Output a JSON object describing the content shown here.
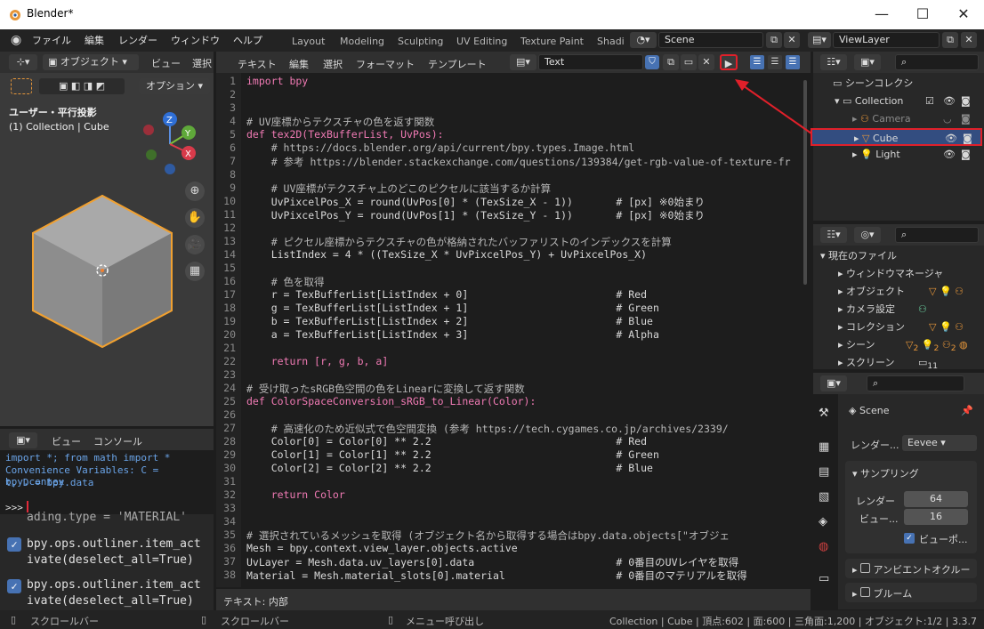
{
  "window": {
    "title": "Blender*",
    "minimize": "—",
    "maximize": "☐",
    "close": "✕"
  },
  "menus": [
    "ファイル",
    "編集",
    "レンダー",
    "ウィンドウ",
    "ヘルプ"
  ],
  "workspaces": [
    "Layout",
    "Modeling",
    "Sculpting",
    "UV Editing",
    "Texture Paint",
    "Shadi"
  ],
  "scene": {
    "name": "Scene"
  },
  "view_layer": {
    "name": "ViewLayer"
  },
  "viewport": {
    "mode": "オブジェクト",
    "menu": [
      "ビュー",
      "選択"
    ],
    "options": "オプション",
    "title": "ユーザー・平行投影",
    "subtitle": "(1) Collection | Cube",
    "axes": {
      "x": "X",
      "y": "Y",
      "z": "Z"
    }
  },
  "text_editor": {
    "menus": [
      "テキスト",
      "編集",
      "選択",
      "フォーマット",
      "テンプレート"
    ],
    "file_name": "Text",
    "footer": "テキスト: 内部",
    "lines": [
      {
        "n": "1",
        "t": "import bpy"
      },
      {
        "n": "2",
        "t": ""
      },
      {
        "n": "3",
        "t": ""
      },
      {
        "n": "4",
        "t": "# UV座標からテクスチャの色を返す関数"
      },
      {
        "n": "5",
        "t": "def tex2D(TexBufferList, UvPos):"
      },
      {
        "n": "6",
        "t": "    # https://docs.blender.org/api/current/bpy.types.Image.html"
      },
      {
        "n": "7",
        "t": "    # 参考 https://blender.stackexchange.com/questions/139384/get-rgb-value-of-texture-fr"
      },
      {
        "n": "8",
        "t": ""
      },
      {
        "n": "9",
        "t": "    # UV座標がテクスチャ上のどこのピクセルに該当するか計算"
      },
      {
        "n": "10",
        "t": "    UvPixcelPos_X = round(UvPos[0] * (TexSize_X - 1))       # [px] ※0始まり"
      },
      {
        "n": "11",
        "t": "    UvPixcelPos_Y = round(UvPos[1] * (TexSize_Y - 1))       # [px] ※0始まり"
      },
      {
        "n": "12",
        "t": ""
      },
      {
        "n": "13",
        "t": "    # ピクセル座標からテクスチャの色が格納されたバッファリストのインデックスを計算"
      },
      {
        "n": "14",
        "t": "    ListIndex = 4 * ((TexSize_X * UvPixcelPos_Y) + UvPixcelPos_X)"
      },
      {
        "n": "15",
        "t": ""
      },
      {
        "n": "16",
        "t": "    # 色を取得"
      },
      {
        "n": "17",
        "t": "    r = TexBufferList[ListIndex + 0]                        # Red"
      },
      {
        "n": "18",
        "t": "    g = TexBufferList[ListIndex + 1]                        # Green"
      },
      {
        "n": "19",
        "t": "    b = TexBufferList[ListIndex + 2]                        # Blue"
      },
      {
        "n": "20",
        "t": "    a = TexBufferList[ListIndex + 3]                        # Alpha"
      },
      {
        "n": "21",
        "t": ""
      },
      {
        "n": "22",
        "t": "    return [r, g, b, a]"
      },
      {
        "n": "23",
        "t": ""
      },
      {
        "n": "24",
        "t": "# 受け取ったsRGB色空間の色をLinearに変換して返す関数"
      },
      {
        "n": "25",
        "t": "def ColorSpaceConversion_sRGB_to_Linear(Color):"
      },
      {
        "n": "26",
        "t": ""
      },
      {
        "n": "27",
        "t": "    # 高速化のため近似式で色空間変換 (参考 https://tech.cygames.co.jp/archives/2339/"
      },
      {
        "n": "28",
        "t": "    Color[0] = Color[0] ** 2.2                              # Red"
      },
      {
        "n": "29",
        "t": "    Color[1] = Color[1] ** 2.2                              # Green"
      },
      {
        "n": "30",
        "t": "    Color[2] = Color[2] ** 2.2                              # Blue"
      },
      {
        "n": "31",
        "t": ""
      },
      {
        "n": "32",
        "t": "    return Color"
      },
      {
        "n": "33",
        "t": ""
      },
      {
        "n": "34",
        "t": ""
      },
      {
        "n": "35",
        "t": "# 選択されているメッシュを取得 (オブジェクト名から取得する場合はbpy.data.objects[\"オブジェ"
      },
      {
        "n": "36",
        "t": "Mesh = bpy.context.view_layer.objects.active"
      },
      {
        "n": "37",
        "t": "UvLayer = Mesh.data.uv_layers[0].data                       # 0番目のUVレイヤを取得"
      },
      {
        "n": "38",
        "t": "Material = Mesh.material_slots[0].material                  # 0番目のマテリアルを取得"
      }
    ]
  },
  "console": {
    "menus": [
      "ビュー",
      "コンソール"
    ],
    "lines": [
      "import *; from math import *",
      "Convenience Variables: C = bpy.contex",
      "t, D = bpy.data"
    ],
    "prompt": ">>> ",
    "history": [
      "ading.type = 'MATERIAL'",
      "bpy.ops.outliner.item_act",
      "ivate(deselect_all=True)",
      "bpy.ops.outliner.item_act",
      "ivate(deselect_all=True)"
    ]
  },
  "outliner": {
    "root": "シーンコレクシ",
    "collection": "Collection",
    "items": [
      "Camera",
      "Cube",
      "Light"
    ]
  },
  "data_browser": {
    "root": "現在のファイル",
    "items": [
      "ウィンドウマネージャ",
      "オブジェクト",
      "カメラ設定",
      "コレクション",
      "シーン",
      "スクリーン"
    ],
    "counts": [
      "2",
      "2",
      "2",
      "11"
    ]
  },
  "properties": {
    "scene": "Scene",
    "render_engine_label": "レンダー...",
    "render_engine": "Eevee",
    "sampling": "サンプリング",
    "render_label": "レンダー",
    "render_value": "64",
    "viewport_label": "ビュー...",
    "viewport_value": "16",
    "viewport_denoise": "ビューポ...",
    "ao": "アンビエントオクルー",
    "bloom": "ブルーム"
  },
  "status": {
    "scroll1": "スクロールバー",
    "scroll2": "スクロールバー",
    "menu_call": "メニュー呼び出し",
    "stats": "Collection | Cube | 頂点:602 | 面:600 | 三角面:1,200 | オブジェクト:1/2 | 3.3.7"
  },
  "colors": {
    "accent": "#e6963a",
    "highlight": "#e0202a",
    "selected": "#334d80"
  }
}
